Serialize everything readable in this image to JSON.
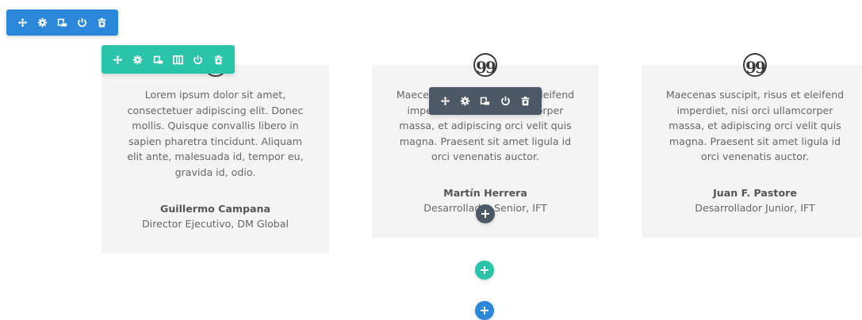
{
  "colors": {
    "section_toolbar": "#2b87da",
    "row_toolbar": "#29c4a9",
    "module_toolbar": "#4c5866",
    "card_bg": "#f4f4f4"
  },
  "toolbars": {
    "section": {
      "icons": [
        "move-icon",
        "settings-icon",
        "duplicate-icon",
        "power-icon",
        "delete-icon"
      ]
    },
    "row": {
      "icons": [
        "move-icon",
        "settings-icon",
        "duplicate-icon",
        "columns-icon",
        "power-icon",
        "delete-icon"
      ]
    },
    "module": {
      "icons": [
        "move-icon",
        "settings-icon",
        "duplicate-icon",
        "power-icon",
        "delete-icon"
      ]
    }
  },
  "testimonials": [
    {
      "quote_icon": "quote-icon",
      "body": "Lorem ipsum dolor sit amet, consectetuer adipiscing elit. Donec mollis. Quisque convallis libero in sapien pharetra tincidunt. Aliquam elit ante, malesuada id, tempor eu, gravida id, odio.",
      "name": "Guillermo Campana",
      "role": "Director Ejecutivo, DM Global"
    },
    {
      "quote_icon": "quote-icon",
      "body": "Maecenas suscipit, risus et eleifend imperdiet, nisi orci ullamcorper massa, et adipiscing orci velit quis magna. Praesent sit amet ligula id orci venenatis auctor.",
      "name": "Martín Herrera",
      "role": "Desarrollador Senior, IFT"
    },
    {
      "quote_icon": "quote-icon",
      "body": "Maecenas suscipit, risus et eleifend imperdiet, nisi orci ullamcorper massa, et adipiscing orci velit quis magna. Praesent sit amet ligula id orci venenatis auctor.",
      "name": "Juan F. Pastore",
      "role": "Desarrollador Junior, IFT"
    }
  ],
  "add_buttons": {
    "module": {
      "icon": "plus-icon",
      "color": "#4c5866"
    },
    "row": {
      "icon": "plus-icon",
      "color": "#29c4a9"
    },
    "section": {
      "icon": "plus-icon",
      "color": "#2b87da"
    }
  },
  "quote_glyph": "99"
}
